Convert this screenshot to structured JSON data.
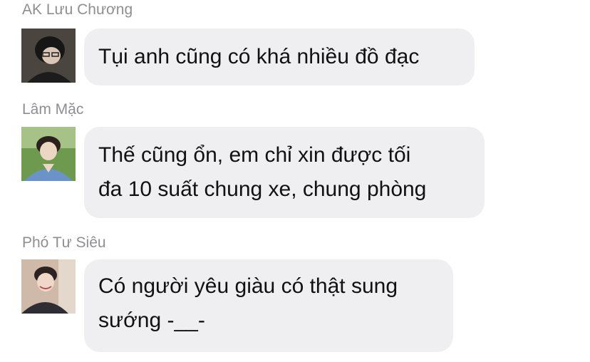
{
  "messages": [
    {
      "sender": "AK Lưu Chương",
      "lines": [
        "Tụi anh cũng có khá nhiều đồ đạc"
      ]
    },
    {
      "sender": "Lâm Mặc",
      "lines": [
        "Thế cũng ổn, em chỉ xin được tối",
        "đa 10 suất chung xe, chung phòng"
      ]
    },
    {
      "sender": "Phó Tư Siêu",
      "lines": [
        "Có người yêu giàu có thật sung",
        "sướng -__-"
      ]
    }
  ]
}
